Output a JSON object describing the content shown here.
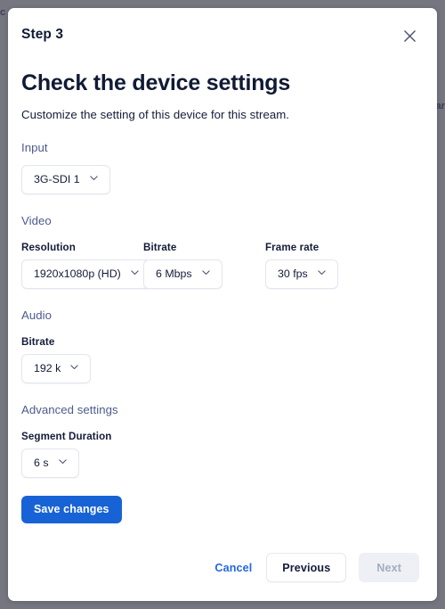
{
  "backdrop": {
    "left_fragment": "c",
    "right_fragment": "ar"
  },
  "modal": {
    "step_label": "Step 3",
    "close_icon": "close-icon",
    "title": "Check the device settings",
    "subtitle": "Customize the setting of this device for this stream.",
    "sections": {
      "input": {
        "heading": "Input",
        "field": {
          "value": "3G-SDI 1",
          "caret_icon": "chevron-down-icon"
        }
      },
      "video": {
        "heading": "Video",
        "fields": [
          {
            "label": "Resolution",
            "value": "1920x1080p (HD)"
          },
          {
            "label": "Bitrate",
            "value": "6 Mbps"
          },
          {
            "label": "Frame rate",
            "value": "30 fps"
          }
        ]
      },
      "audio": {
        "heading": "Audio",
        "fields": [
          {
            "label": "Bitrate",
            "value": "192 k"
          }
        ]
      },
      "advanced": {
        "heading": "Advanced settings",
        "fields": [
          {
            "label": "Segment Duration",
            "value": "6 s"
          }
        ]
      }
    },
    "save_button": "Save changes"
  },
  "footer": {
    "cancel": "Cancel",
    "previous": "Previous",
    "next": "Next"
  },
  "colors": {
    "accent": "#1763d6",
    "link": "#2468de",
    "section_heading": "#4d5b8c",
    "text": "#141c38",
    "backdrop": "#767680",
    "disabled_bg": "#eef0f5",
    "disabled_text": "#a6adbf"
  }
}
